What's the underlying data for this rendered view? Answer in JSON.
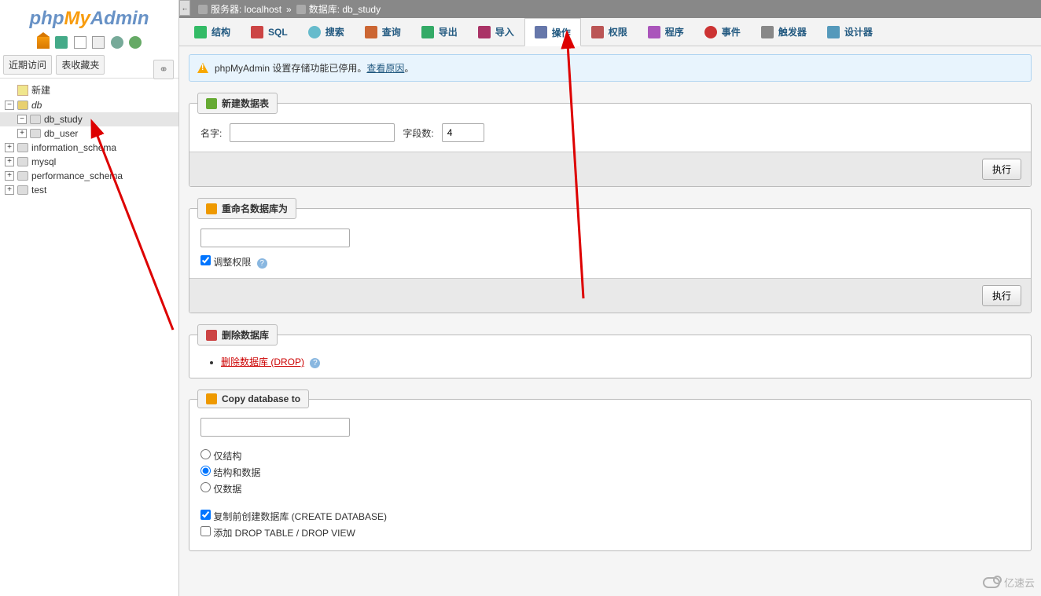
{
  "logo": {
    "php": "php",
    "my": "My",
    "admin": "Admin"
  },
  "recentTabs": {
    "recent": "近期访问",
    "fav": "表收藏夹"
  },
  "tree": {
    "new": "新建",
    "db": "db",
    "db_study": "db_study",
    "db_user": "db_user",
    "information_schema": "information_schema",
    "mysql": "mysql",
    "performance_schema": "performance_schema",
    "test": "test"
  },
  "breadcrumb": {
    "server_label": "服务器: localhost",
    "db_label": "数据库: db_study"
  },
  "tabs": {
    "structure": "结构",
    "sql": "SQL",
    "search": "搜索",
    "query": "查询",
    "export": "导出",
    "import": "导入",
    "operations": "操作",
    "privileges": "权限",
    "procedures": "程序",
    "events": "事件",
    "triggers": "触发器",
    "designer": "设计器"
  },
  "notice": {
    "text": "phpMyAdmin 设置存储功能已停用。",
    "link": "查看原因",
    "suffix": "。"
  },
  "panels": {
    "create": {
      "legend": "新建数据表",
      "name_label": "名字:",
      "cols_label": "字段数:",
      "cols_value": "4",
      "submit": "执行"
    },
    "rename": {
      "legend": "重命名数据库为",
      "adjust": "调整权限",
      "submit": "执行"
    },
    "drop": {
      "legend": "删除数据库",
      "link": "删除数据库 (DROP)"
    },
    "copy": {
      "legend": "Copy database to",
      "opt_structure": "仅结构",
      "opt_both": "结构和数据",
      "opt_data": "仅数据",
      "chk_create": "复制前创建数据库 (CREATE DATABASE)",
      "chk_drop": "添加 DROP TABLE / DROP VIEW"
    }
  },
  "watermark": "亿速云"
}
